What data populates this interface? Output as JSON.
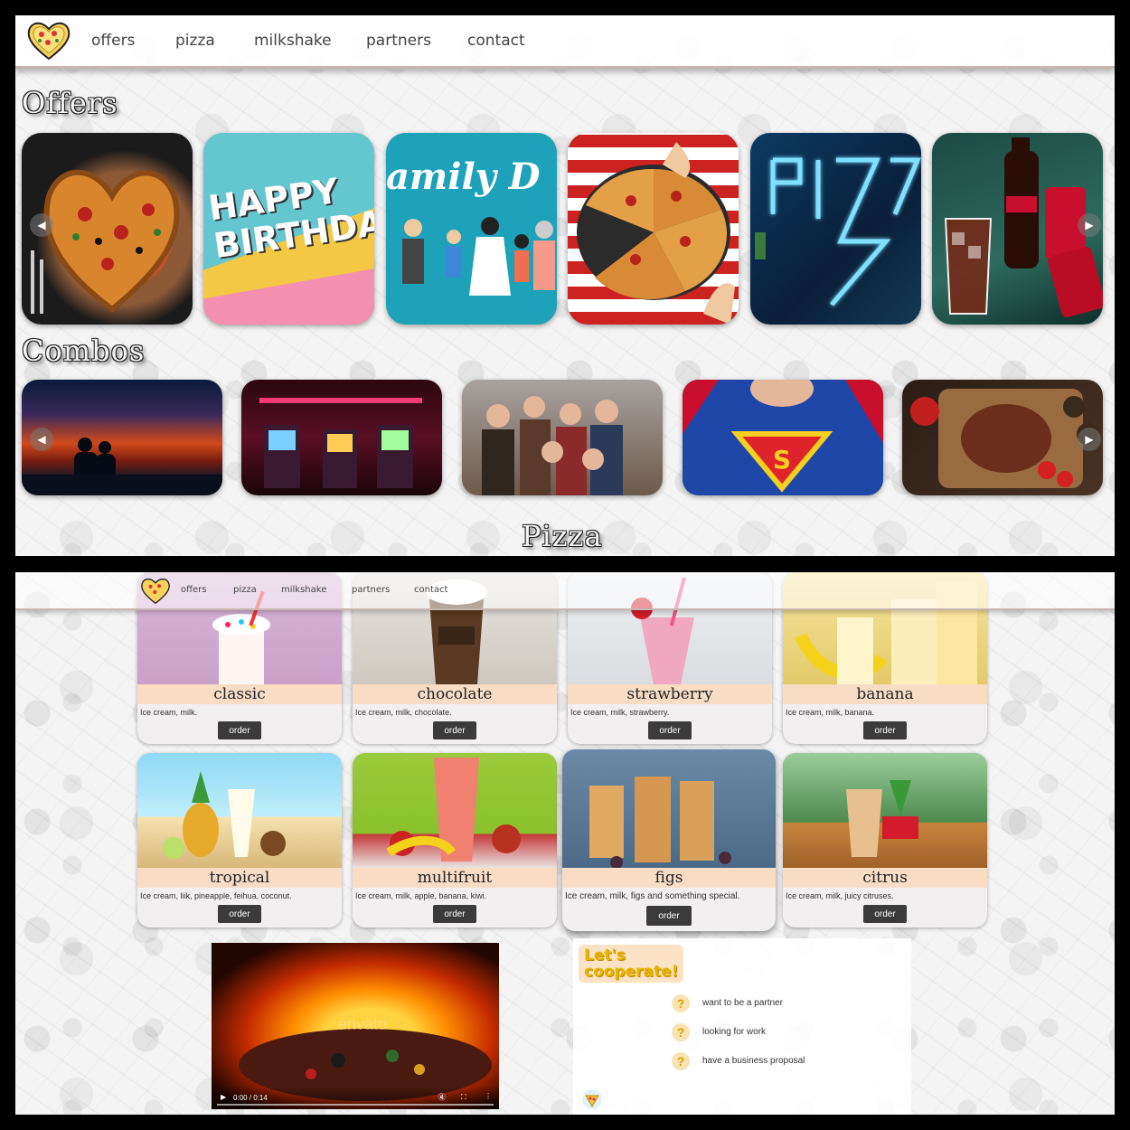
{
  "top_nav": {
    "logo": "pizza-heart-logo",
    "links": [
      "offers",
      "pizza",
      "milkshake",
      "partners",
      "contact"
    ]
  },
  "sections": {
    "offers": "Offers",
    "combos": "Combos",
    "pizza": "Pizza"
  },
  "offers": [
    {
      "name": "heart-pizza",
      "text": ""
    },
    {
      "name": "happy-birthday",
      "text": "HAPPY BIRTHDAY"
    },
    {
      "name": "family-day",
      "text": "amily D"
    },
    {
      "name": "pizza-sharing",
      "text": ""
    },
    {
      "name": "neon-pizza-sign",
      "text": ""
    },
    {
      "name": "cola-drinks",
      "text": ""
    }
  ],
  "combos": [
    "sunset-couple",
    "arcade-room",
    "friends-group",
    "superman",
    "steak-board"
  ],
  "bottom_nav": {
    "links": [
      "offers",
      "pizza",
      "milkshake",
      "partners",
      "contact"
    ]
  },
  "milkshakes": [
    {
      "name": "classic",
      "desc": "Ice cream, milk.",
      "button": "order"
    },
    {
      "name": "chocolate",
      "desc": "Ice cream, milk, chocolate.",
      "button": "order"
    },
    {
      "name": "strawberry",
      "desc": "Ice cream, milk, strawberry.",
      "button": "order"
    },
    {
      "name": "banana",
      "desc": "Ice cream, milk, banana.",
      "button": "order"
    },
    {
      "name": "tropical",
      "desc": "Ice cream, liik, pineapple, feihua, coconut.",
      "button": "order"
    },
    {
      "name": "multifruit",
      "desc": "Ice cream, milk, apple, banana, kiwi.",
      "button": "order"
    },
    {
      "name": "figs",
      "desc": "Ice cream, milk, figs and something special.",
      "button": "order"
    },
    {
      "name": "citrus",
      "desc": "Ice cream, milk, juicy citruses.",
      "button": "order"
    }
  ],
  "video": {
    "time": "0:00 / 0:14",
    "watermark": "envato"
  },
  "cooperate": {
    "title_line1": "Let's",
    "title_line2": "cooperate!",
    "items": [
      "want to be a partner",
      "looking for work",
      "have a business proposal"
    ]
  }
}
